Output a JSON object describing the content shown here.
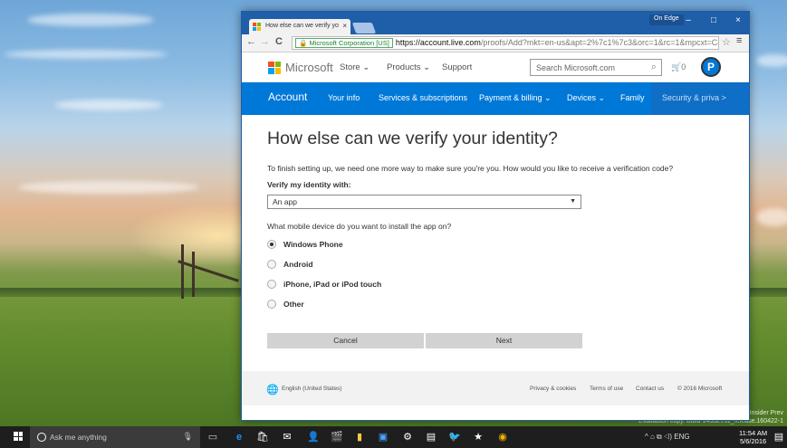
{
  "browser": {
    "tab_title": "How else can we verify yo",
    "tab_close": "×",
    "profile_badge": "On Edge",
    "controls": {
      "minimize": "–",
      "maximize": "□",
      "close": "×"
    },
    "nav": {
      "back": "←",
      "forward": "→",
      "reload": "C"
    },
    "ev_badge": "Microsoft Corporation [US]",
    "url_host": "https://account.live.com",
    "url_path": "/proofs/Add?mkt=en-us&apt=2%7c1%7c3&orc=1&rc=1&mpcxt=CatA",
    "star": "☆",
    "menu": "≡"
  },
  "ms_header": {
    "brand": "Microsoft",
    "nav": [
      "Store ⌄",
      "Products ⌄",
      "Support"
    ],
    "search_placeholder": "Search Microsoft.com",
    "search_icon": "⌕",
    "cart": "🛒0",
    "avatar_letter": "P",
    "logo_colors": [
      "#f25022",
      "#7fba00",
      "#00a4ef",
      "#ffb900"
    ]
  },
  "account_nav": {
    "title": "Account",
    "items": [
      "Your info",
      "Services & subscriptions",
      "Payment & billing ⌄",
      "Devices ⌄",
      "Family",
      "Security & priva  >"
    ],
    "accent": "#0078d7"
  },
  "main": {
    "heading": "How else can we verify your identity?",
    "intro": "To finish setting up, we need one more way to make sure you're you. How would you like to receive a verification code?",
    "verify_label": "Verify my identity with:",
    "verify_value": "An app",
    "device_question": "What mobile device do you want to install the app on?",
    "options": [
      {
        "label": "Windows Phone",
        "checked": true
      },
      {
        "label": "Android",
        "checked": false
      },
      {
        "label": "iPhone, iPad or iPod touch",
        "checked": false
      },
      {
        "label": "Other",
        "checked": false
      }
    ],
    "cancel_label": "Cancel",
    "next_label": "Next"
  },
  "footer": {
    "language": "English (United States)",
    "links": [
      "Privacy & cookies",
      "Terms of use",
      "Contact us",
      "© 2016 Microsoft"
    ]
  },
  "desktop": {
    "watermark_line1": "Windows 10 Pro Insider Prev",
    "watermark_line2": "Evaluation copy. Build 14332.rs1_release.160422-1"
  },
  "taskbar": {
    "search_placeholder": "Ask me anything",
    "tray_text": "^  ⌂  ⧉  ◁)  ENG",
    "time": "11:54 AM",
    "date": "5/6/2016",
    "icons": [
      "task-view-icon",
      "edge-icon",
      "store-icon",
      "mail-icon",
      "people-icon",
      "movies-icon",
      "office-icon",
      "news-icon",
      "settings-icon",
      "photos-icon",
      "twitter-icon",
      "wunderlist-icon",
      "chrome-icon"
    ]
  }
}
